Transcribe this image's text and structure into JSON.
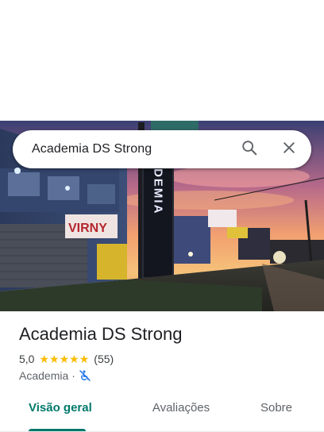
{
  "search": {
    "query": "Academia DS Strong"
  },
  "hero": {
    "sign_vertical": "ACADEMIA",
    "sign_store": "VIRNY"
  },
  "place": {
    "name": "Academia DS Strong",
    "rating": "5,0",
    "stars": 5,
    "review_count": "(55)",
    "category": "Academia",
    "separator": "·"
  },
  "tabs": [
    {
      "label": "Visão geral",
      "active": true
    },
    {
      "label": "Avaliações",
      "active": false
    },
    {
      "label": "Sobre",
      "active": false
    }
  ],
  "colors": {
    "accent": "#00796b",
    "star": "#fbbc04",
    "access_icon": "#1a73e8"
  }
}
